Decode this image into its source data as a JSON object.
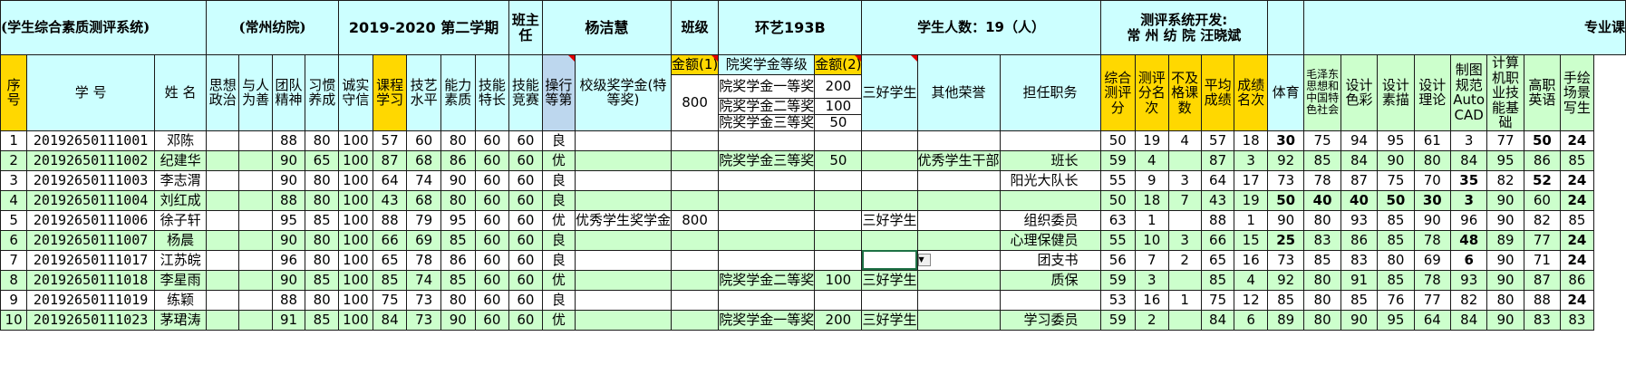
{
  "header": {
    "title": "(学生综合素质测评系统)",
    "school": "(常州纺院)",
    "term": "2019-2020 第二学期",
    "head_teacher_label": "班主任",
    "head_teacher": "杨洁慧",
    "class_label": "班级",
    "class_name": "环艺193B",
    "student_count": "学生人数：19（人）",
    "developer_line1": "测评系统开发:",
    "developer_line2": "常 州 纺 院  汪晓斌",
    "major_label": "专业课"
  },
  "columns": {
    "seq": "序号",
    "sid": "学 号",
    "name": "姓 名",
    "c1": "思想政治",
    "c2": "与人为善",
    "c3": "团队精神",
    "c4": "习惯养成",
    "c5": "诚实守信",
    "c6": "课程学习",
    "c7": "技艺水平",
    "c8": "能力素质",
    "c9": "技能特长",
    "c10": "技能竞赛",
    "c11": "操行等第",
    "c12": "校级奖学金(特等奖)",
    "amount1_label": "金额(1)",
    "amount1_value": "800",
    "scholar_label": "院奖学金等级",
    "amount2_label": "金额(2)",
    "tier1": "院奖学金一等奖",
    "tier1_amount": "200",
    "tier2": "院奖学金二等奖",
    "tier2_amount": "100",
    "tier3": "院奖学金三等奖",
    "tier3_amount": "50",
    "c13": "三好学生",
    "c14": "其他荣誉",
    "c15": "担任职务",
    "c16": "综合测评分",
    "c17": "测评分名次",
    "c18": "不及格课数",
    "c19": "平均成绩",
    "c20": "成绩名次",
    "c21": "体育",
    "c22": "毛泽东思想和中国特色社会",
    "c23": "设计色彩",
    "c24": "设计素描",
    "c25": "设计理论",
    "c26": "制图规范AutoCAD",
    "c27": "计算机职业技能基础",
    "c28": "高职英语",
    "c29": "手绘场景写生"
  },
  "rows": [
    {
      "seq": "1",
      "sid": "20192650111001",
      "name": "邓陈",
      "c3": "88",
      "c4": "80",
      "c5": "100",
      "c6": "57",
      "c7": "60",
      "c8": "80",
      "c9": "60",
      "c10": "60",
      "grade": "良",
      "scholar": "",
      "amt1": "",
      "tier": "",
      "amt2": "",
      "sanhao": "",
      "honor": "",
      "duty": "",
      "total": "50",
      "rank": "19",
      "fail": "4",
      "avg": "57",
      "srank": "18",
      "s1": "30",
      "s2": "75",
      "s3": "94",
      "s4": "95",
      "s5": "61",
      "s6": "3",
      "s7": "77",
      "s8": "50",
      "s9": "24"
    },
    {
      "seq": "2",
      "sid": "20192650111002",
      "name": "纪建华",
      "c3": "90",
      "c4": "65",
      "c5": "100",
      "c6": "87",
      "c7": "68",
      "c8": "86",
      "c9": "60",
      "c10": "60",
      "grade": "优",
      "scholar": "",
      "amt1": "",
      "tier": "院奖学金三等奖",
      "amt2": "50",
      "sanhao": "",
      "honor": "优秀学生干部",
      "duty": "班长",
      "total": "59",
      "rank": "4",
      "fail": "",
      "avg": "87",
      "srank": "3",
      "s1": "92",
      "s2": "85",
      "s3": "84",
      "s4": "90",
      "s5": "80",
      "s6": "84",
      "s7": "95",
      "s8": "86",
      "s9": "85"
    },
    {
      "seq": "3",
      "sid": "20192650111003",
      "name": "李志渭",
      "c3": "90",
      "c4": "80",
      "c5": "100",
      "c6": "64",
      "c7": "74",
      "c8": "90",
      "c9": "60",
      "c10": "60",
      "grade": "良",
      "scholar": "",
      "amt1": "",
      "tier": "",
      "amt2": "",
      "sanhao": "",
      "honor": "",
      "duty": "阳光大队长",
      "total": "55",
      "rank": "9",
      "fail": "3",
      "avg": "64",
      "srank": "17",
      "s1": "73",
      "s2": "78",
      "s3": "87",
      "s4": "75",
      "s5": "70",
      "s6": "35",
      "s7": "82",
      "s8": "52",
      "s9": "24"
    },
    {
      "seq": "4",
      "sid": "20192650111004",
      "name": "刘红成",
      "c3": "88",
      "c4": "80",
      "c5": "100",
      "c6": "43",
      "c7": "68",
      "c8": "80",
      "c9": "60",
      "c10": "60",
      "grade": "良",
      "scholar": "",
      "amt1": "",
      "tier": "",
      "amt2": "",
      "sanhao": "",
      "honor": "",
      "duty": "",
      "total": "50",
      "rank": "18",
      "fail": "7",
      "avg": "43",
      "srank": "19",
      "s1": "50",
      "s2": "40",
      "s3": "40",
      "s4": "50",
      "s5": "30",
      "s6": "3",
      "s7": "90",
      "s8": "60",
      "s9": "24"
    },
    {
      "seq": "5",
      "sid": "20192650111006",
      "name": "徐子轩",
      "c3": "95",
      "c4": "85",
      "c5": "100",
      "c6": "88",
      "c7": "79",
      "c8": "95",
      "c9": "60",
      "c10": "60",
      "grade": "优",
      "scholar": "优秀学生奖学金",
      "amt1": "800",
      "tier": "",
      "amt2": "",
      "sanhao": "三好学生",
      "honor": "",
      "duty": "组织委员",
      "total": "63",
      "rank": "1",
      "fail": "",
      "avg": "88",
      "srank": "1",
      "s1": "90",
      "s2": "80",
      "s3": "93",
      "s4": "85",
      "s5": "90",
      "s6": "96",
      "s7": "90",
      "s8": "82",
      "s9": "85"
    },
    {
      "seq": "6",
      "sid": "20192650111007",
      "name": "杨晨",
      "c3": "90",
      "c4": "80",
      "c5": "100",
      "c6": "66",
      "c7": "69",
      "c8": "85",
      "c9": "60",
      "c10": "60",
      "grade": "良",
      "scholar": "",
      "amt1": "",
      "tier": "",
      "amt2": "",
      "sanhao": "",
      "honor": "",
      "duty": "心理保健员",
      "total": "55",
      "rank": "10",
      "fail": "3",
      "avg": "66",
      "srank": "15",
      "s1": "25",
      "s2": "83",
      "s3": "86",
      "s4": "85",
      "s5": "78",
      "s6": "48",
      "s7": "89",
      "s8": "77",
      "s9": "24"
    },
    {
      "seq": "7",
      "sid": "20192650111017",
      "name": "江苏皖",
      "c3": "96",
      "c4": "80",
      "c5": "100",
      "c6": "65",
      "c7": "78",
      "c8": "86",
      "c9": "60",
      "c10": "60",
      "grade": "良",
      "scholar": "",
      "amt1": "",
      "tier": "",
      "amt2": "",
      "sanhao": "",
      "honor": "",
      "duty": "团支书",
      "total": "56",
      "rank": "7",
      "fail": "2",
      "avg": "65",
      "srank": "16",
      "s1": "73",
      "s2": "85",
      "s3": "83",
      "s4": "80",
      "s5": "69",
      "s6": "6",
      "s7": "90",
      "s8": "71",
      "s9": "24"
    },
    {
      "seq": "8",
      "sid": "20192650111018",
      "name": "李星雨",
      "c3": "90",
      "c4": "85",
      "c5": "100",
      "c6": "85",
      "c7": "74",
      "c8": "85",
      "c9": "60",
      "c10": "60",
      "grade": "优",
      "scholar": "",
      "amt1": "",
      "tier": "院奖学金二等奖",
      "amt2": "100",
      "sanhao": "三好学生",
      "honor": "",
      "duty": "质保",
      "total": "59",
      "rank": "3",
      "fail": "",
      "avg": "85",
      "srank": "4",
      "s1": "92",
      "s2": "80",
      "s3": "91",
      "s4": "85",
      "s5": "78",
      "s6": "93",
      "s7": "90",
      "s8": "87",
      "s9": "86"
    },
    {
      "seq": "9",
      "sid": "20192650111019",
      "name": "练颖",
      "c3": "88",
      "c4": "80",
      "c5": "100",
      "c6": "75",
      "c7": "73",
      "c8": "80",
      "c9": "60",
      "c10": "60",
      "grade": "良",
      "scholar": "",
      "amt1": "",
      "tier": "",
      "amt2": "",
      "sanhao": "",
      "honor": "",
      "duty": "",
      "total": "53",
      "rank": "16",
      "fail": "1",
      "avg": "75",
      "srank": "12",
      "s1": "85",
      "s2": "80",
      "s3": "85",
      "s4": "76",
      "s5": "77",
      "s6": "82",
      "s7": "80",
      "s8": "88",
      "s9": "24"
    },
    {
      "seq": "10",
      "sid": "20192650111023",
      "name": "茅珺涛",
      "c3": "91",
      "c4": "85",
      "c5": "100",
      "c6": "84",
      "c7": "73",
      "c8": "90",
      "c9": "60",
      "c10": "60",
      "grade": "优",
      "scholar": "",
      "amt1": "",
      "tier": "院奖学金一等奖",
      "amt2": "200",
      "sanhao": "三好学生",
      "honor": "",
      "duty": "学习委员",
      "total": "59",
      "rank": "2",
      "fail": "",
      "avg": "84",
      "srank": "6",
      "s1": "89",
      "s2": "80",
      "s3": "90",
      "s4": "95",
      "s5": "64",
      "s6": "84",
      "s7": "90",
      "s8": "83",
      "s9": "83"
    }
  ],
  "red_scores": {
    "1": [
      "s1",
      "s8",
      "s9"
    ],
    "3": [
      "s6",
      "s8",
      "s9"
    ],
    "4": [
      "s1",
      "s2",
      "s3",
      "s4",
      "s5",
      "s6",
      "s9"
    ],
    "6": [
      "s1",
      "s6",
      "s9"
    ],
    "7": [
      "s6",
      "s9"
    ],
    "9": [
      "s9"
    ],
    "10": []
  },
  "colors": {
    "header_sky": "#ccffff",
    "header_yellow": "#ffd800",
    "row_green": "#ccffcc",
    "red_text": "#e00000"
  }
}
